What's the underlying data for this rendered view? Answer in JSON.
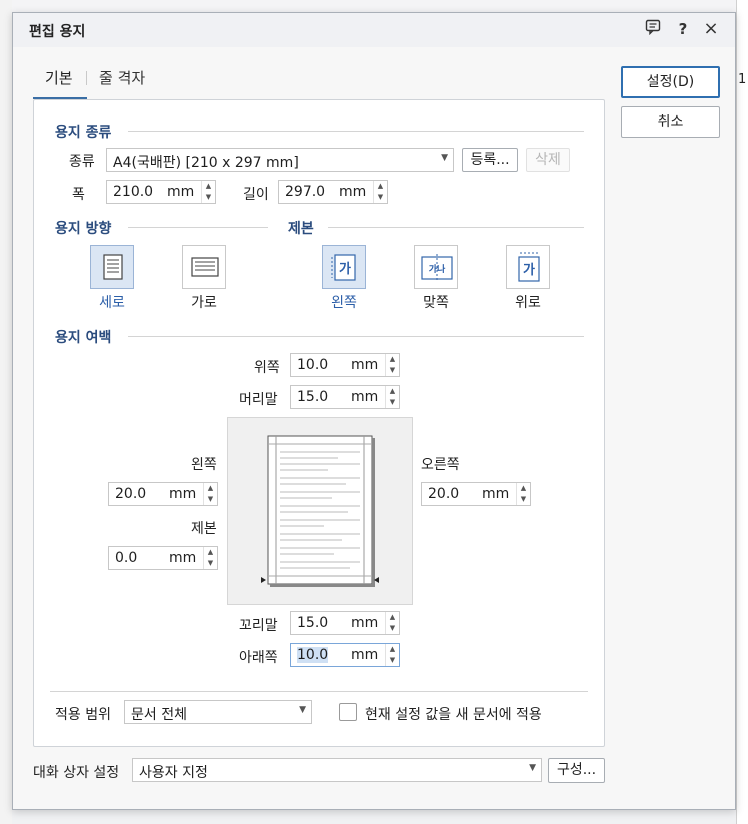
{
  "dialog": {
    "title": "편집 용지",
    "titlebar_icons": [
      "feedback-icon",
      "help-icon",
      "close-icon"
    ],
    "help_glyph": "?",
    "close_glyph": "×"
  },
  "tabs": [
    {
      "label": "기본",
      "active": true
    },
    {
      "label": "줄 격자",
      "active": false
    }
  ],
  "buttons": {
    "ok": "설정(D)",
    "cancel": "취소",
    "register": "등록...",
    "delete": "삭제",
    "configure": "구성..."
  },
  "paper_kind": {
    "section": "용지 종류",
    "kind_label": "종류",
    "kind_value": "A4(국배판)  [210 x 297 mm]",
    "width_label": "폭",
    "width_value": "210.0",
    "length_label": "길이",
    "length_value": "297.0",
    "unit": "mm"
  },
  "orientation": {
    "section": "용지 방향",
    "portrait": "세로",
    "landscape": "가로",
    "selected": "세로"
  },
  "binding": {
    "section": "제본",
    "left": "왼쪽",
    "facing": "맞쪽",
    "top": "위로",
    "selected": "왼쪽",
    "icon_glyph": "가",
    "facing_glyph": "가나"
  },
  "margins": {
    "section": "용지 여백",
    "unit": "mm",
    "top_label": "위쪽",
    "top_value": "10.0",
    "header_label": "머리말",
    "header_value": "15.0",
    "left_label": "왼쪽",
    "left_value": "20.0",
    "gutter_label": "제본",
    "gutter_value": "0.0",
    "right_label": "오른쪽",
    "right_value": "20.0",
    "footer_label": "꼬리말",
    "footer_value": "15.0",
    "bottom_label": "아래쪽",
    "bottom_value": "10.0"
  },
  "apply": {
    "label": "적용 범위",
    "value": "문서 전체",
    "checkbox_label": "현재 설정 값을 새 문서에 적용",
    "checked": false
  },
  "dialog_settings": {
    "label": "대화 상자 설정",
    "value": "사용자 지정"
  },
  "background": {
    "ruler_text": "1"
  }
}
